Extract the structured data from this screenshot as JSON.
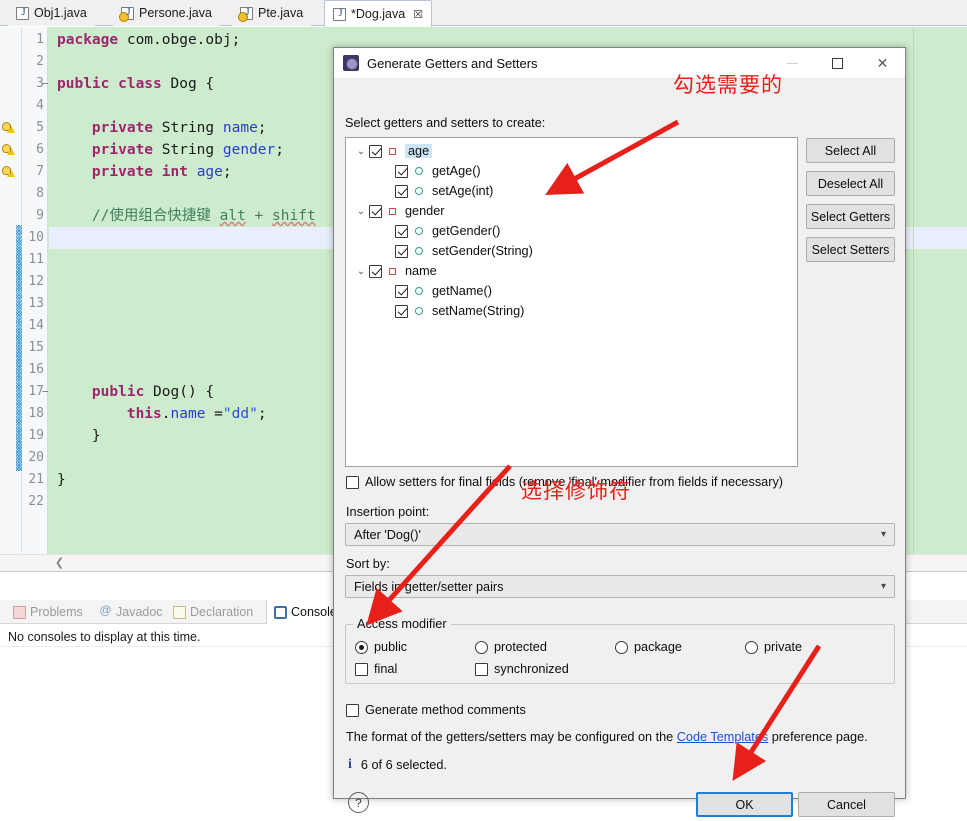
{
  "editor": {
    "tabs": [
      {
        "label": "Obj1.java",
        "icon": "java-file-icon",
        "warning": false,
        "active": false,
        "close": false
      },
      {
        "label": "Persone.java",
        "icon": "java-file-icon",
        "warning": true,
        "active": false,
        "close": false
      },
      {
        "label": "Pte.java",
        "icon": "java-file-icon",
        "warning": true,
        "active": false,
        "close": false
      },
      {
        "label": "*Dog.java",
        "icon": "java-file-icon",
        "warning": false,
        "active": true,
        "close": true,
        "close_glyph": "☒"
      }
    ],
    "lines": [
      {
        "n": "1",
        "html": "<span class='kw'>package</span> com.obge.obj;"
      },
      {
        "n": "2",
        "html": ""
      },
      {
        "n": "3",
        "html": "<span class='kw'>public class</span> Dog {"
      },
      {
        "n": "4",
        "html": ""
      },
      {
        "n": "5",
        "html": "    <span class='kw'>private</span> String <span class='fld'>name</span>;"
      },
      {
        "n": "6",
        "html": "    <span class='kw'>private</span> String <span class='fld'>gender</span>;"
      },
      {
        "n": "7",
        "html": "    <span class='kw'>private</span> <span class='kw'>int</span> <span class='fld'>age</span>;"
      },
      {
        "n": "8",
        "html": ""
      },
      {
        "n": "9",
        "html": "    <span class='cmt'>//使用组合快捷键 <span class='sq'>alt</span> + <span class='sq'>shift</span></span>"
      },
      {
        "n": "10",
        "html": ""
      },
      {
        "n": "11",
        "html": ""
      },
      {
        "n": "12",
        "html": ""
      },
      {
        "n": "13",
        "html": ""
      },
      {
        "n": "14",
        "html": ""
      },
      {
        "n": "15",
        "html": ""
      },
      {
        "n": "16",
        "html": ""
      },
      {
        "n": "17",
        "html": "    <span class='kw'>public</span> Dog() {"
      },
      {
        "n": "18",
        "html": "        <span class='kw'>this</span>.<span class='fld'>name</span> =<span class='str'>\"dd\"</span>;"
      },
      {
        "n": "19",
        "html": "    }"
      },
      {
        "n": "20",
        "html": ""
      },
      {
        "n": "21",
        "html": "}"
      },
      {
        "n": "22",
        "html": ""
      }
    ]
  },
  "bottom_panel": {
    "tabs": [
      {
        "label": "Problems",
        "icon": "problems-icon",
        "active": false
      },
      {
        "label": "Javadoc",
        "icon": "javadoc-icon",
        "active": false
      },
      {
        "label": "Declaration",
        "icon": "declaration-icon",
        "active": false
      },
      {
        "label": "Console",
        "icon": "console-icon",
        "active": true
      }
    ],
    "message": "No consoles to display at this time."
  },
  "dialog": {
    "title": "Generate Getters and Setters",
    "icon": "eclipse-gear-icon",
    "window_buttons": {
      "minimize": "minimize-button",
      "maximize": "maximize-button",
      "close": "✕"
    },
    "prompt": "Select getters and setters to create:",
    "tree": [
      {
        "level": 0,
        "label": "age",
        "checked": true,
        "expanded": true,
        "kind": "field",
        "selected": true
      },
      {
        "level": 1,
        "label": "getAge()",
        "checked": true,
        "expanded": false,
        "kind": "method",
        "selected": false
      },
      {
        "level": 1,
        "label": "setAge(int)",
        "checked": true,
        "expanded": false,
        "kind": "method",
        "selected": false
      },
      {
        "level": 0,
        "label": "gender",
        "checked": true,
        "expanded": true,
        "kind": "field",
        "selected": false
      },
      {
        "level": 1,
        "label": "getGender()",
        "checked": true,
        "expanded": false,
        "kind": "method",
        "selected": false
      },
      {
        "level": 1,
        "label": "setGender(String)",
        "checked": true,
        "expanded": false,
        "kind": "method",
        "selected": false
      },
      {
        "level": 0,
        "label": "name",
        "checked": true,
        "expanded": true,
        "kind": "field",
        "selected": false
      },
      {
        "level": 1,
        "label": "getName()",
        "checked": true,
        "expanded": false,
        "kind": "method",
        "selected": false
      },
      {
        "level": 1,
        "label": "setName(String)",
        "checked": true,
        "expanded": false,
        "kind": "method",
        "selected": false
      }
    ],
    "side_buttons": [
      {
        "label": "Select All"
      },
      {
        "label": "Deselect All"
      },
      {
        "label": "Select Getters"
      },
      {
        "label": "Select Setters"
      }
    ],
    "allow_setters": {
      "label": "Allow setters for final fields (remove 'final' modifier from fields if necessary)",
      "checked": false
    },
    "insertion_point": {
      "label": "Insertion point:",
      "value": "After 'Dog()'"
    },
    "sort_by": {
      "label": "Sort by:",
      "value": "Fields in getter/setter pairs"
    },
    "access_modifier": {
      "title": "Access modifier",
      "radios": [
        {
          "label": "public",
          "selected": true
        },
        {
          "label": "protected",
          "selected": false
        },
        {
          "label": "package",
          "selected": false
        },
        {
          "label": "private",
          "selected": false
        }
      ],
      "checks": [
        {
          "label": "final",
          "checked": false
        },
        {
          "label": "synchronized",
          "checked": false
        }
      ]
    },
    "generate_comments": {
      "label": "Generate method comments",
      "checked": false
    },
    "format_note": {
      "before": "The format of the getters/setters may be configured on the ",
      "link": "Code Templates",
      "after": " preference page."
    },
    "status": {
      "icon": "info-icon",
      "glyph": "i",
      "text": "6 of 6 selected."
    },
    "help_button": {
      "glyph": "?",
      "name": "help-button"
    },
    "buttons": [
      {
        "label": "OK",
        "default": true
      },
      {
        "label": "Cancel",
        "default": false
      }
    ]
  },
  "annotations": [
    {
      "text": "勾选需要的",
      "note": "check the ones you need"
    },
    {
      "text": "选择修饰符",
      "note": "select the modifier"
    }
  ],
  "colors": {
    "editor_background": "#cdeccd",
    "current_line": "#e8eefb",
    "keyword": "#a0256e",
    "field": "#2b3cc8",
    "string": "#2a4fd8",
    "comment": "#3f7f5f",
    "annotation_red": "#e8201a",
    "dialog_background": "#f0f0f0",
    "tree_selection": "#cde6f7",
    "default_button_border": "#1f7fd0"
  }
}
